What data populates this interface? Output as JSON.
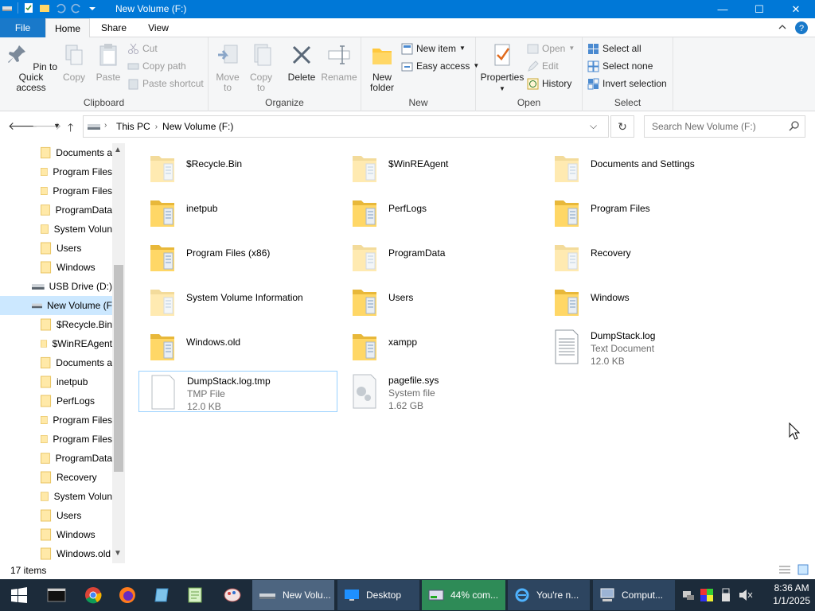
{
  "window": {
    "title": "New Volume (F:)",
    "minimize": "—",
    "maximize": "☐",
    "close": "✕"
  },
  "ribbon_tabs": [
    {
      "label": "File"
    },
    {
      "label": "Home"
    },
    {
      "label": "Share"
    },
    {
      "label": "View"
    }
  ],
  "clipboard": {
    "pin": "Pin to Quick access",
    "copy": "Copy",
    "paste": "Paste",
    "cut": "Cut",
    "copy_path": "Copy path",
    "paste_shortcut": "Paste shortcut",
    "label": "Clipboard"
  },
  "organize": {
    "move_to": "Move to",
    "copy_to": "Copy to",
    "delete": "Delete",
    "rename": "Rename",
    "label": "Organize"
  },
  "new_group": {
    "new_folder": "New folder",
    "new_item": "New item",
    "easy_access": "Easy access",
    "label": "New"
  },
  "open_group": {
    "properties": "Properties",
    "open": "Open",
    "edit": "Edit",
    "history": "History",
    "label": "Open"
  },
  "select_group": {
    "select_all": "Select all",
    "select_none": "Select none",
    "invert": "Invert selection",
    "label": "Select"
  },
  "address": {
    "crumbs": [
      "This PC",
      "New Volume (F:)"
    ],
    "search_placeholder": "Search New Volume (F:)"
  },
  "nav_pane": [
    {
      "label": "Documents a",
      "type": "folder"
    },
    {
      "label": "Program Files",
      "type": "folder"
    },
    {
      "label": "Program Files",
      "type": "folder"
    },
    {
      "label": "ProgramData",
      "type": "folder"
    },
    {
      "label": "System Volun",
      "type": "folder"
    },
    {
      "label": "Users",
      "type": "folder"
    },
    {
      "label": "Windows",
      "type": "folder"
    },
    {
      "label": "USB Drive (D:)",
      "type": "drive"
    },
    {
      "label": "New Volume (F",
      "type": "drive",
      "selected": true
    },
    {
      "label": "$Recycle.Bin",
      "type": "folder"
    },
    {
      "label": "$WinREAgent",
      "type": "folder"
    },
    {
      "label": "Documents a",
      "type": "folder"
    },
    {
      "label": "inetpub",
      "type": "folder"
    },
    {
      "label": "PerfLogs",
      "type": "folder"
    },
    {
      "label": "Program Files",
      "type": "folder"
    },
    {
      "label": "Program Files",
      "type": "folder"
    },
    {
      "label": "ProgramData",
      "type": "folder"
    },
    {
      "label": "Recovery",
      "type": "folder"
    },
    {
      "label": "System Volun",
      "type": "folder"
    },
    {
      "label": "Users",
      "type": "folder"
    },
    {
      "label": "Windows",
      "type": "folder"
    },
    {
      "label": "Windows.old",
      "type": "folder"
    }
  ],
  "files": [
    {
      "name": "$Recycle.Bin",
      "kind": "folder-faded"
    },
    {
      "name": "$WinREAgent",
      "kind": "folder-faded"
    },
    {
      "name": "Documents and Settings",
      "kind": "folder-faded"
    },
    {
      "name": "inetpub",
      "kind": "folder"
    },
    {
      "name": "PerfLogs",
      "kind": "folder"
    },
    {
      "name": "Program Files",
      "kind": "folder"
    },
    {
      "name": "Program Files (x86)",
      "kind": "folder"
    },
    {
      "name": "ProgramData",
      "kind": "folder-faded"
    },
    {
      "name": "Recovery",
      "kind": "folder-faded"
    },
    {
      "name": "System Volume Information",
      "kind": "folder-faded"
    },
    {
      "name": "Users",
      "kind": "folder"
    },
    {
      "name": "Windows",
      "kind": "folder"
    },
    {
      "name": "Windows.old",
      "kind": "folder"
    },
    {
      "name": "xampp",
      "kind": "folder"
    },
    {
      "name": "DumpStack.log",
      "type": "Text Document",
      "size": "12.0 KB",
      "kind": "text"
    },
    {
      "name": "DumpStack.log.tmp",
      "type": "TMP File",
      "size": "12.0 KB",
      "kind": "blank",
      "selected": true
    },
    {
      "name": "pagefile.sys",
      "type": "System file",
      "size": "1.62 GB",
      "kind": "sys"
    }
  ],
  "status": {
    "count": "17 items"
  },
  "taskbar": {
    "windows": [
      {
        "label": "New Volu...",
        "active": true
      },
      {
        "label": "Desktop"
      },
      {
        "label": "44% com..."
      },
      {
        "label": "You're n..."
      },
      {
        "label": "Comput..."
      }
    ],
    "time": "8:36 AM",
    "date": "1/1/2025"
  },
  "colors": {
    "accent": "#0078d7",
    "folder": "#ffd766",
    "taskbar": "#1c2b3a",
    "selection": "#cce8ff"
  }
}
